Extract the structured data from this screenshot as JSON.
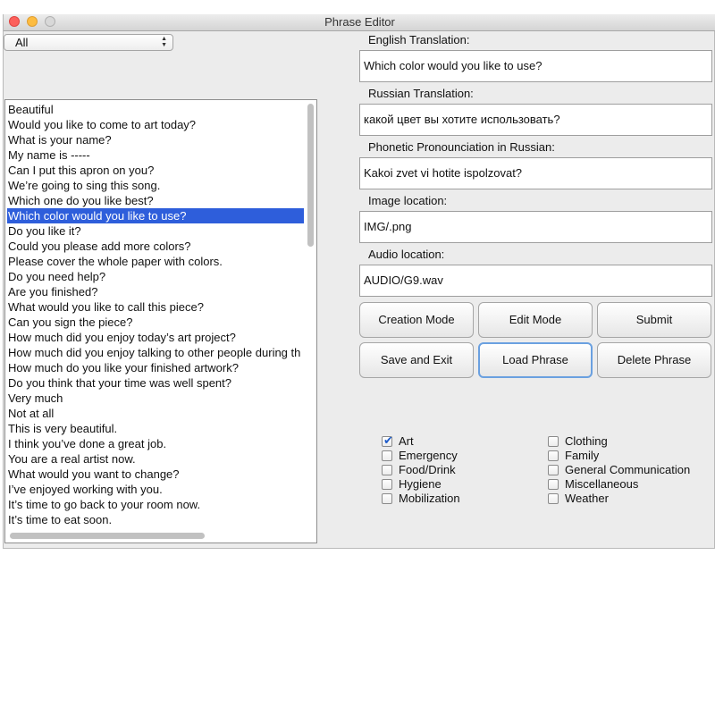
{
  "window": {
    "title": "Phrase Editor"
  },
  "filter": {
    "selected": "All"
  },
  "phrases": [
    "Beautiful",
    "Would you like to come to art today?",
    "What is your name?",
    "My name is -----",
    "Can I put this apron on you?",
    "We’re going to sing this song.",
    "Which one do you like best?",
    "Which color would you like to use?",
    "Do you like it?",
    "Could you please add more colors?",
    "Please cover the whole paper with colors.",
    "Do you need help?",
    "Are you finished?",
    "What would you like to call this piece?",
    "Can you sign the piece?",
    "How much did you enjoy today’s art project?",
    "How much did you enjoy talking to other people during th",
    "How much do you like your finished artwork?",
    "Do you think that your time was well spent?",
    "Very much",
    "Not at all",
    "This is very beautiful.",
    "I think you’ve done a great job.",
    "You are a real artist now.",
    "What would you want to change?",
    "I’ve enjoyed working with you.",
    "It’s time to go back to your room now.",
    "It’s time to eat soon."
  ],
  "selected_phrase": "Which color would you like to use?",
  "fields": {
    "english_label": "English Translation:",
    "english_value": "Which color would you like to use?",
    "russian_label": "Russian Translation:",
    "russian_value": "какой цвет вы хотите использовать?",
    "phonetic_label": "Phonetic Pronounciation in Russian:",
    "phonetic_value": "Kakoi zvet vi hotite ispolzovat?",
    "image_label": "Image location:",
    "image_value": "IMG/.png",
    "audio_label": "Audio location:",
    "audio_value": "AUDIO/G9.wav"
  },
  "buttons": {
    "creation_mode": "Creation Mode",
    "edit_mode": "Edit Mode",
    "submit": "Submit",
    "save_exit": "Save and Exit",
    "load_phrase": "Load Phrase",
    "delete_phrase": "Delete Phrase"
  },
  "categories": {
    "art": {
      "label": "Art",
      "checked": true
    },
    "emergency": {
      "label": "Emergency",
      "checked": false
    },
    "food_drink": {
      "label": "Food/Drink",
      "checked": false
    },
    "hygiene": {
      "label": "Hygiene",
      "checked": false
    },
    "mobilization": {
      "label": "Mobilization",
      "checked": false
    },
    "clothing": {
      "label": "Clothing",
      "checked": false
    },
    "family": {
      "label": "Family",
      "checked": false
    },
    "general_communication": {
      "label": "General Communication",
      "checked": false
    },
    "miscellaneous": {
      "label": "Miscellaneous",
      "checked": false
    },
    "weather": {
      "label": "Weather",
      "checked": false
    }
  },
  "colors": {
    "selection": "#2e5edb",
    "focus_ring": "#6aa0e0"
  }
}
